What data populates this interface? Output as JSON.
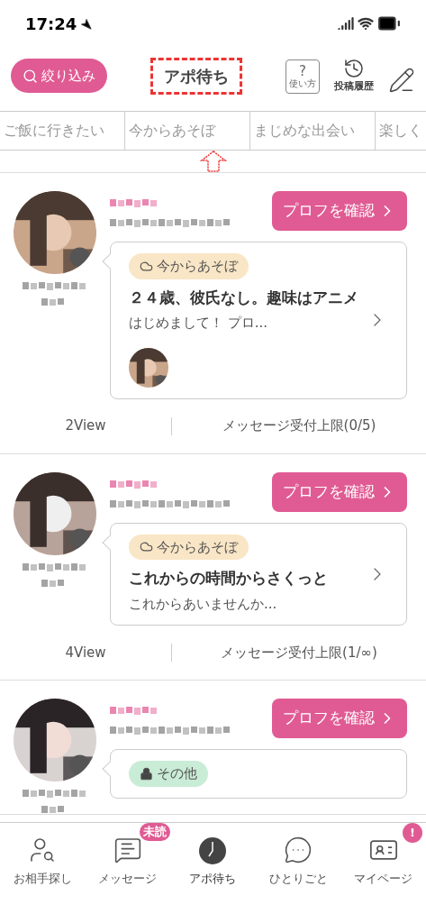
{
  "status_bar": {
    "time": "17:24"
  },
  "header": {
    "filter_button": "絞り込み",
    "title": "アポ待ち",
    "help_mark": "?",
    "help_label": "使い方",
    "history_label": "投稿履歴"
  },
  "categories": [
    {
      "label": "ご飯に行きたい"
    },
    {
      "label": "今からあそぼ"
    },
    {
      "label": "まじめな出会い"
    },
    {
      "label": "楽しく"
    }
  ],
  "posts": [
    {
      "button": "プロフを確認",
      "tag": {
        "kind": "now",
        "label": "今からあそぼ"
      },
      "title": "２４歳、彼氏なし。趣味はアニメ",
      "body": "はじめまして！ プロ...",
      "views": "2View",
      "limit": "メッセージ受付上限(0/5)"
    },
    {
      "button": "プロフを確認",
      "tag": {
        "kind": "now",
        "label": "今からあそぼ"
      },
      "title": "これからの時間からさくっと",
      "body": "これからあいませんか...",
      "views": "4View",
      "limit": "メッセージ受付上限(1/∞)"
    },
    {
      "button": "プロフを確認",
      "tag": {
        "kind": "other",
        "label": "その他"
      }
    }
  ],
  "tab_bar": [
    {
      "kind": "search",
      "label": "お相手探し",
      "selected": false
    },
    {
      "kind": "message",
      "label": "メッセージ",
      "selected": false,
      "badge": "未読"
    },
    {
      "kind": "appo",
      "label": "アポ待ち",
      "selected": true
    },
    {
      "kind": "talk",
      "label": "ひとりごと",
      "selected": false
    },
    {
      "kind": "mypage",
      "label": "マイページ",
      "selected": false,
      "badge": "!"
    }
  ]
}
